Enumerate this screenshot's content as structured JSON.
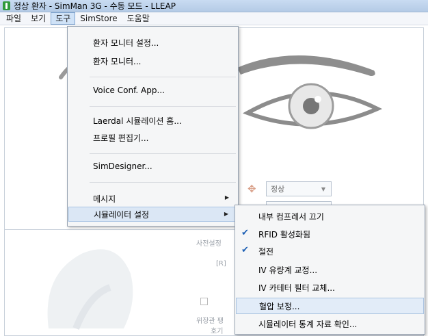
{
  "window": {
    "title": "정상 환자 - SimMan 3G - 수동 모드 - LLEAP"
  },
  "menubar": {
    "items": [
      {
        "label": "파일"
      },
      {
        "label": "보기"
      },
      {
        "label": "도구"
      },
      {
        "label": "SimStore"
      },
      {
        "label": "도움말"
      }
    ]
  },
  "tools_menu": {
    "items": [
      {
        "label": "환자 모니터 설정..."
      },
      {
        "label": "환자 모니터..."
      },
      {
        "label": "Voice Conf. App..."
      },
      {
        "label": "Laerdal 시뮬레이션 홈..."
      },
      {
        "label": "프로필 편집기..."
      },
      {
        "label": "SimDesigner..."
      },
      {
        "label": "메시지"
      },
      {
        "label": "시뮬레이터 설정"
      }
    ]
  },
  "simulator_settings_submenu": {
    "items": [
      {
        "label": "내부 컴프레서 끄기",
        "checked": false
      },
      {
        "label": "RFID 활성화됨",
        "checked": true
      },
      {
        "label": "절전",
        "checked": true
      },
      {
        "label": "IV 유량계 교정...",
        "checked": false
      },
      {
        "label": "IV 카테터 필터 교체...",
        "checked": false
      },
      {
        "label": "혈압 보정...",
        "checked": false
      },
      {
        "label": "시뮬레이터 통계 자료 확인...",
        "checked": false
      }
    ]
  },
  "background": {
    "pupil_dropdown_value": "정상",
    "label_presets": "사전설정",
    "label_r": "[R]",
    "label_stomach": "위장관 팽",
    "label_checkbox": "호기"
  },
  "colors": {
    "menu_highlight": "#dbe7f5",
    "check_color": "#1c5fb4",
    "titlebar": "#c9dcf2"
  }
}
